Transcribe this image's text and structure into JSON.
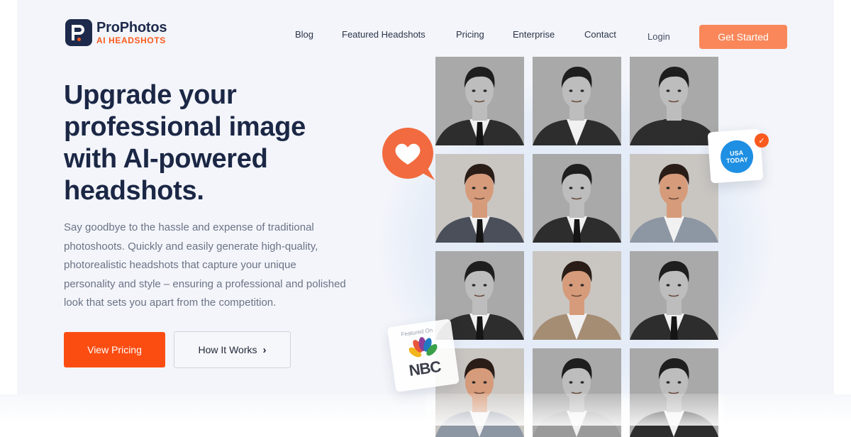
{
  "brand": {
    "name": "ProPhotos",
    "tagline": "AI HEADSHOTS",
    "accent": "#fb4d12",
    "navy": "#1b2745"
  },
  "nav": {
    "items": [
      {
        "label": "Blog"
      },
      {
        "label": "Featured Headshots"
      },
      {
        "label": "Pricing"
      },
      {
        "label": "Enterprise"
      },
      {
        "label": "Contact"
      }
    ],
    "login": "Login",
    "cta": "Get Started"
  },
  "hero": {
    "headline": "Upgrade your professional image with AI-powered headshots.",
    "paragraph": "Say goodbye to the hassle and expense of traditional photoshoots. Quickly and easily generate high-quality, photorealistic headshots that capture your unique personality and style – ensuring a professional and polished look that sets you apart from the competition.",
    "primary_button": "View Pricing",
    "secondary_button": "How It Works"
  },
  "badges": {
    "usa_today": [
      "USA",
      "TODAY"
    ],
    "featured_label": "Featured On",
    "nbc": "NBC"
  },
  "gallery": {
    "tiles": [
      {
        "tone": "bw",
        "style": "suit"
      },
      {
        "tone": "bw",
        "style": "jacket"
      },
      {
        "tone": "bw",
        "style": "tee"
      },
      {
        "tone": "color",
        "style": "suit"
      },
      {
        "tone": "bw",
        "style": "suit"
      },
      {
        "tone": "color",
        "style": "shirt"
      },
      {
        "tone": "bw",
        "style": "suit"
      },
      {
        "tone": "color",
        "style": "coat"
      },
      {
        "tone": "bw",
        "style": "suit"
      },
      {
        "tone": "color",
        "style": "shirt"
      },
      {
        "tone": "bw",
        "style": "coat"
      },
      {
        "tone": "bw",
        "style": "jacket"
      }
    ]
  }
}
